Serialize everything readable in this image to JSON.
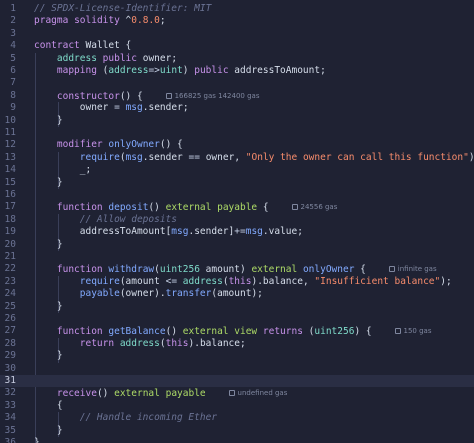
{
  "editor": {
    "lines": [
      {
        "n": "1",
        "tokens": [
          [
            "cm",
            "// SPDX-License-Identifier: MIT"
          ]
        ]
      },
      {
        "n": "2",
        "tokens": [
          [
            "kw",
            "pragma"
          ],
          [
            "pun",
            " "
          ],
          [
            "kw",
            "solidity"
          ],
          [
            "pun",
            " ^"
          ],
          [
            "num",
            "0.8.0"
          ],
          [
            "pun",
            ";"
          ]
        ]
      },
      {
        "n": "3",
        "tokens": []
      },
      {
        "n": "4",
        "tokens": [
          [
            "kw",
            "contract"
          ],
          [
            "pun",
            " "
          ],
          [
            "id",
            "Wallet"
          ],
          [
            "pun",
            " {"
          ]
        ]
      },
      {
        "n": "5",
        "tokens": [
          [
            "pun",
            "    "
          ],
          [
            "ty",
            "address"
          ],
          [
            "pun",
            " "
          ],
          [
            "kw",
            "public"
          ],
          [
            "pun",
            " "
          ],
          [
            "id",
            "owner"
          ],
          [
            "pun",
            ";"
          ]
        ]
      },
      {
        "n": "6",
        "tokens": [
          [
            "pun",
            "    "
          ],
          [
            "kw",
            "mapping"
          ],
          [
            "pun",
            " ("
          ],
          [
            "ty",
            "address"
          ],
          [
            "op",
            "=>"
          ],
          [
            "ty",
            "uint"
          ],
          [
            "pun",
            ") "
          ],
          [
            "kw",
            "public"
          ],
          [
            "pun",
            " "
          ],
          [
            "id",
            "addressToAmount"
          ],
          [
            "pun",
            ";"
          ]
        ]
      },
      {
        "n": "7",
        "tokens": []
      },
      {
        "n": "8",
        "tokens": [
          [
            "pun",
            "    "
          ],
          [
            "kw",
            "constructor"
          ],
          [
            "pun",
            "() {"
          ]
        ],
        "lens": "166825 gas 142400 gas"
      },
      {
        "n": "9",
        "tokens": [
          [
            "pun",
            "        "
          ],
          [
            "id",
            "owner"
          ],
          [
            "pun",
            " "
          ],
          [
            "op",
            "="
          ],
          [
            "pun",
            " "
          ],
          [
            "glob",
            "msg"
          ],
          [
            "pun",
            "."
          ],
          [
            "id",
            "sender"
          ],
          [
            "pun",
            ";"
          ]
        ]
      },
      {
        "n": "10",
        "tokens": [
          [
            "pun",
            "    }"
          ]
        ]
      },
      {
        "n": "11",
        "tokens": []
      },
      {
        "n": "12",
        "tokens": [
          [
            "pun",
            "    "
          ],
          [
            "kw",
            "modifier"
          ],
          [
            "pun",
            " "
          ],
          [
            "fn",
            "onlyOwner"
          ],
          [
            "pun",
            "() {"
          ]
        ]
      },
      {
        "n": "13",
        "tokens": [
          [
            "pun",
            "        "
          ],
          [
            "fn",
            "require"
          ],
          [
            "pun",
            "("
          ],
          [
            "glob",
            "msg"
          ],
          [
            "pun",
            "."
          ],
          [
            "id",
            "sender"
          ],
          [
            "pun",
            " "
          ],
          [
            "op",
            "=="
          ],
          [
            "pun",
            " "
          ],
          [
            "id",
            "owner"
          ],
          [
            "pun",
            ", "
          ],
          [
            "str",
            "\"Only the owner can call this function\""
          ],
          [
            "pun",
            ");"
          ]
        ]
      },
      {
        "n": "14",
        "tokens": [
          [
            "pun",
            "        "
          ],
          [
            "id",
            "_"
          ],
          [
            "pun",
            ";"
          ]
        ]
      },
      {
        "n": "15",
        "tokens": [
          [
            "pun",
            "    }"
          ]
        ]
      },
      {
        "n": "16",
        "tokens": []
      },
      {
        "n": "17",
        "tokens": [
          [
            "pun",
            "    "
          ],
          [
            "kw",
            "function"
          ],
          [
            "pun",
            " "
          ],
          [
            "fn",
            "deposit"
          ],
          [
            "pun",
            "() "
          ],
          [
            "mod",
            "external"
          ],
          [
            "pun",
            " "
          ],
          [
            "mod",
            "payable"
          ],
          [
            "pun",
            " {"
          ]
        ],
        "lens": "24556 gas"
      },
      {
        "n": "18",
        "tokens": [
          [
            "pun",
            "        "
          ],
          [
            "cm",
            "// Allow deposits"
          ]
        ]
      },
      {
        "n": "19",
        "tokens": [
          [
            "pun",
            "        "
          ],
          [
            "id",
            "addressToAmount"
          ],
          [
            "pun",
            "["
          ],
          [
            "glob",
            "msg"
          ],
          [
            "pun",
            "."
          ],
          [
            "id",
            "sender"
          ],
          [
            "pun",
            "]"
          ],
          [
            "op",
            "+="
          ],
          [
            "glob",
            "msg"
          ],
          [
            "pun",
            "."
          ],
          [
            "id",
            "value"
          ],
          [
            "pun",
            ";"
          ]
        ]
      },
      {
        "n": "20",
        "tokens": [
          [
            "pun",
            "    }"
          ]
        ]
      },
      {
        "n": "21",
        "tokens": []
      },
      {
        "n": "22",
        "tokens": [
          [
            "pun",
            "    "
          ],
          [
            "kw",
            "function"
          ],
          [
            "pun",
            " "
          ],
          [
            "fn",
            "withdraw"
          ],
          [
            "pun",
            "("
          ],
          [
            "ty",
            "uint256"
          ],
          [
            "pun",
            " "
          ],
          [
            "id",
            "amount"
          ],
          [
            "pun",
            ") "
          ],
          [
            "mod",
            "external"
          ],
          [
            "pun",
            " "
          ],
          [
            "fn",
            "onlyOwner"
          ],
          [
            "pun",
            " {"
          ]
        ],
        "lens": "infinite gas"
      },
      {
        "n": "23",
        "tokens": [
          [
            "pun",
            "        "
          ],
          [
            "fn",
            "require"
          ],
          [
            "pun",
            "("
          ],
          [
            "id",
            "amount"
          ],
          [
            "pun",
            " "
          ],
          [
            "op",
            "<="
          ],
          [
            "pun",
            " "
          ],
          [
            "ty",
            "address"
          ],
          [
            "pun",
            "("
          ],
          [
            "kw",
            "this"
          ],
          [
            "pun",
            ")."
          ],
          [
            "id",
            "balance"
          ],
          [
            "pun",
            ", "
          ],
          [
            "str",
            "\"Insufficient balance\""
          ],
          [
            "pun",
            ");"
          ]
        ]
      },
      {
        "n": "24",
        "tokens": [
          [
            "pun",
            "        "
          ],
          [
            "fn",
            "payable"
          ],
          [
            "pun",
            "("
          ],
          [
            "id",
            "owner"
          ],
          [
            "pun",
            ")."
          ],
          [
            "fn",
            "transfer"
          ],
          [
            "pun",
            "("
          ],
          [
            "id",
            "amount"
          ],
          [
            "pun",
            ");"
          ]
        ]
      },
      {
        "n": "25",
        "tokens": [
          [
            "pun",
            "    }"
          ]
        ]
      },
      {
        "n": "26",
        "tokens": []
      },
      {
        "n": "27",
        "tokens": [
          [
            "pun",
            "    "
          ],
          [
            "kw",
            "function"
          ],
          [
            "pun",
            " "
          ],
          [
            "fn",
            "getBalance"
          ],
          [
            "pun",
            "() "
          ],
          [
            "mod",
            "external"
          ],
          [
            "pun",
            " "
          ],
          [
            "mod",
            "view"
          ],
          [
            "pun",
            " "
          ],
          [
            "kw",
            "returns"
          ],
          [
            "pun",
            " ("
          ],
          [
            "ty",
            "uint256"
          ],
          [
            "pun",
            ") {"
          ]
        ],
        "lens": "150 gas"
      },
      {
        "n": "28",
        "tokens": [
          [
            "pun",
            "        "
          ],
          [
            "kw",
            "return"
          ],
          [
            "pun",
            " "
          ],
          [
            "ty",
            "address"
          ],
          [
            "pun",
            "("
          ],
          [
            "kw",
            "this"
          ],
          [
            "pun",
            ")."
          ],
          [
            "id",
            "balance"
          ],
          [
            "pun",
            ";"
          ]
        ]
      },
      {
        "n": "29",
        "tokens": [
          [
            "pun",
            "    }"
          ]
        ]
      },
      {
        "n": "30",
        "tokens": []
      },
      {
        "n": "31",
        "tokens": [],
        "active": true
      },
      {
        "n": "32",
        "tokens": [
          [
            "pun",
            "    "
          ],
          [
            "kw",
            "receive"
          ],
          [
            "pun",
            "() "
          ],
          [
            "mod",
            "external"
          ],
          [
            "pun",
            " "
          ],
          [
            "mod",
            "payable"
          ]
        ],
        "lens": "undefined gas"
      },
      {
        "n": "33",
        "tokens": [
          [
            "pun",
            "    {"
          ]
        ]
      },
      {
        "n": "34",
        "tokens": [
          [
            "pun",
            "        "
          ],
          [
            "cm",
            "// Handle incoming Ether"
          ]
        ]
      },
      {
        "n": "35",
        "tokens": [
          [
            "pun",
            "    }"
          ]
        ]
      },
      {
        "n": "36",
        "tokens": [
          [
            "pun",
            "}"
          ]
        ]
      }
    ]
  }
}
